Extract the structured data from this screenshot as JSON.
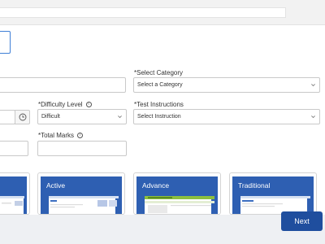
{
  "form": {
    "category_label": "*Select Category",
    "category_value": "Select a Category",
    "difficulty_label": "*Difficulty Level",
    "difficulty_value": "Difficult",
    "instructions_label": "*Test Instructions",
    "instructions_value": "Select Instruction",
    "total_marks_label": "*Total Marks"
  },
  "themes": [
    {
      "title": ""
    },
    {
      "title": "Active"
    },
    {
      "title": "Advance"
    },
    {
      "title": "Traditional"
    }
  ],
  "footer": {
    "next_label": "Next"
  },
  "colors": {
    "primary": "#1f4e9e",
    "theme_blue": "#2e5fb2",
    "focus_border": "#3f7fd6"
  }
}
